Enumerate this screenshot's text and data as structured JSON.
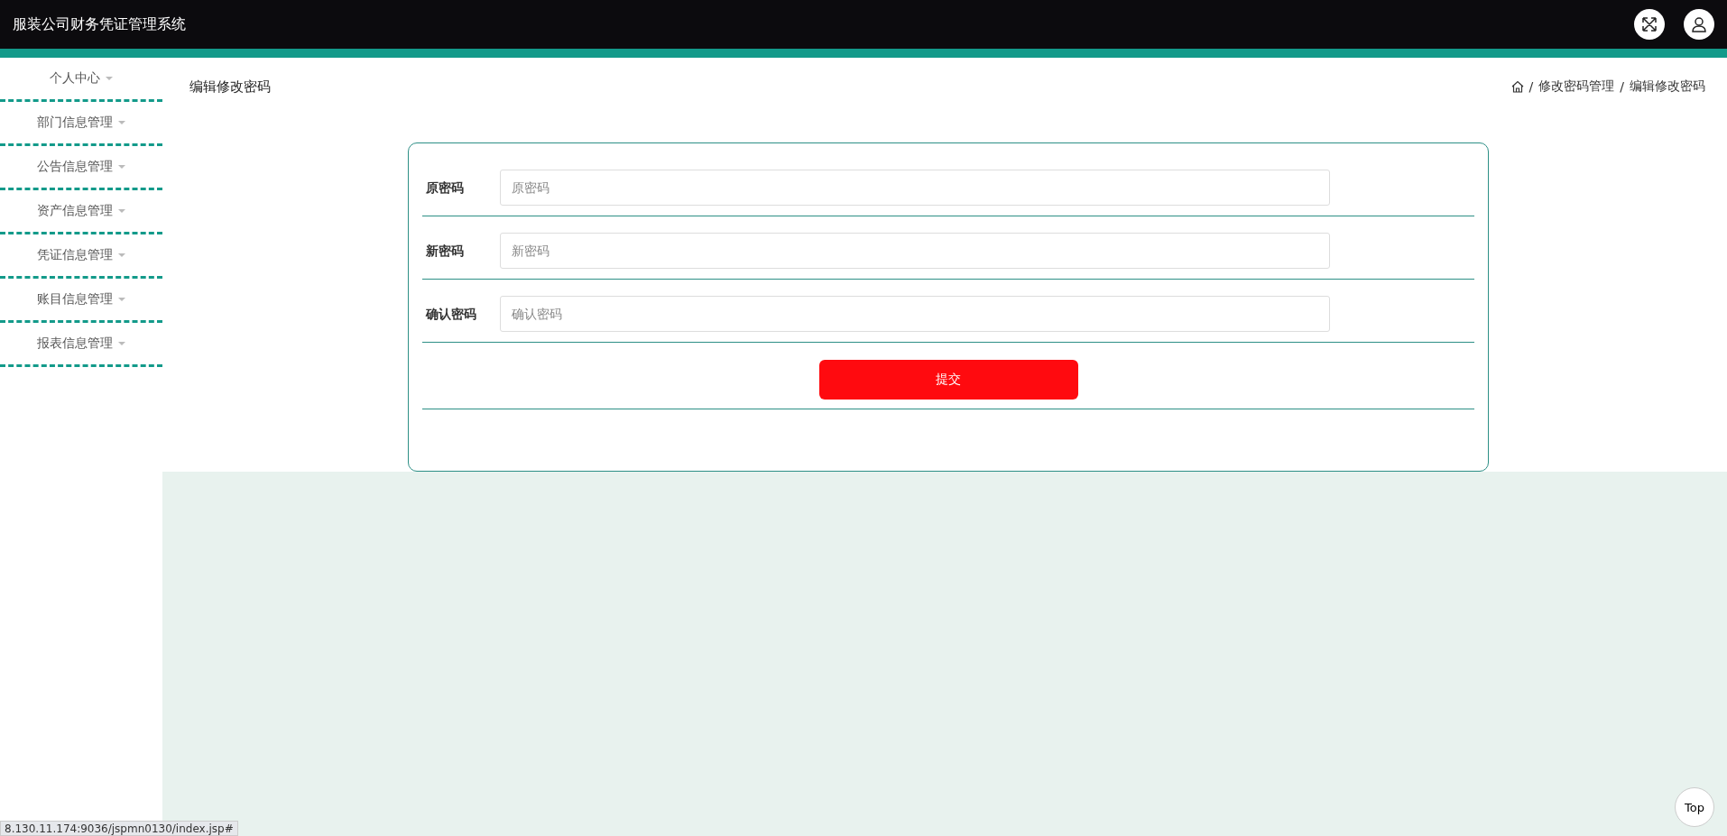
{
  "header": {
    "title": "服装公司财务凭证管理系统"
  },
  "sidebar": {
    "items": [
      {
        "label": "个人中心"
      },
      {
        "label": "部门信息管理"
      },
      {
        "label": "公告信息管理"
      },
      {
        "label": "资产信息管理"
      },
      {
        "label": "凭证信息管理"
      },
      {
        "label": "账目信息管理"
      },
      {
        "label": "报表信息管理"
      }
    ]
  },
  "page_title": "编辑修改密码",
  "breadcrumb": {
    "separator": "/",
    "items": [
      "修改密码管理",
      "编辑修改密码"
    ]
  },
  "form": {
    "fields": [
      {
        "label": "原密码",
        "placeholder": "原密码"
      },
      {
        "label": "新密码",
        "placeholder": "新密码"
      },
      {
        "label": "确认密码",
        "placeholder": "确认密码"
      }
    ],
    "submit": "提交"
  },
  "top_button": "Top",
  "status_url": "8.130.11.174:9036/jspmn0130/index.jsp#"
}
